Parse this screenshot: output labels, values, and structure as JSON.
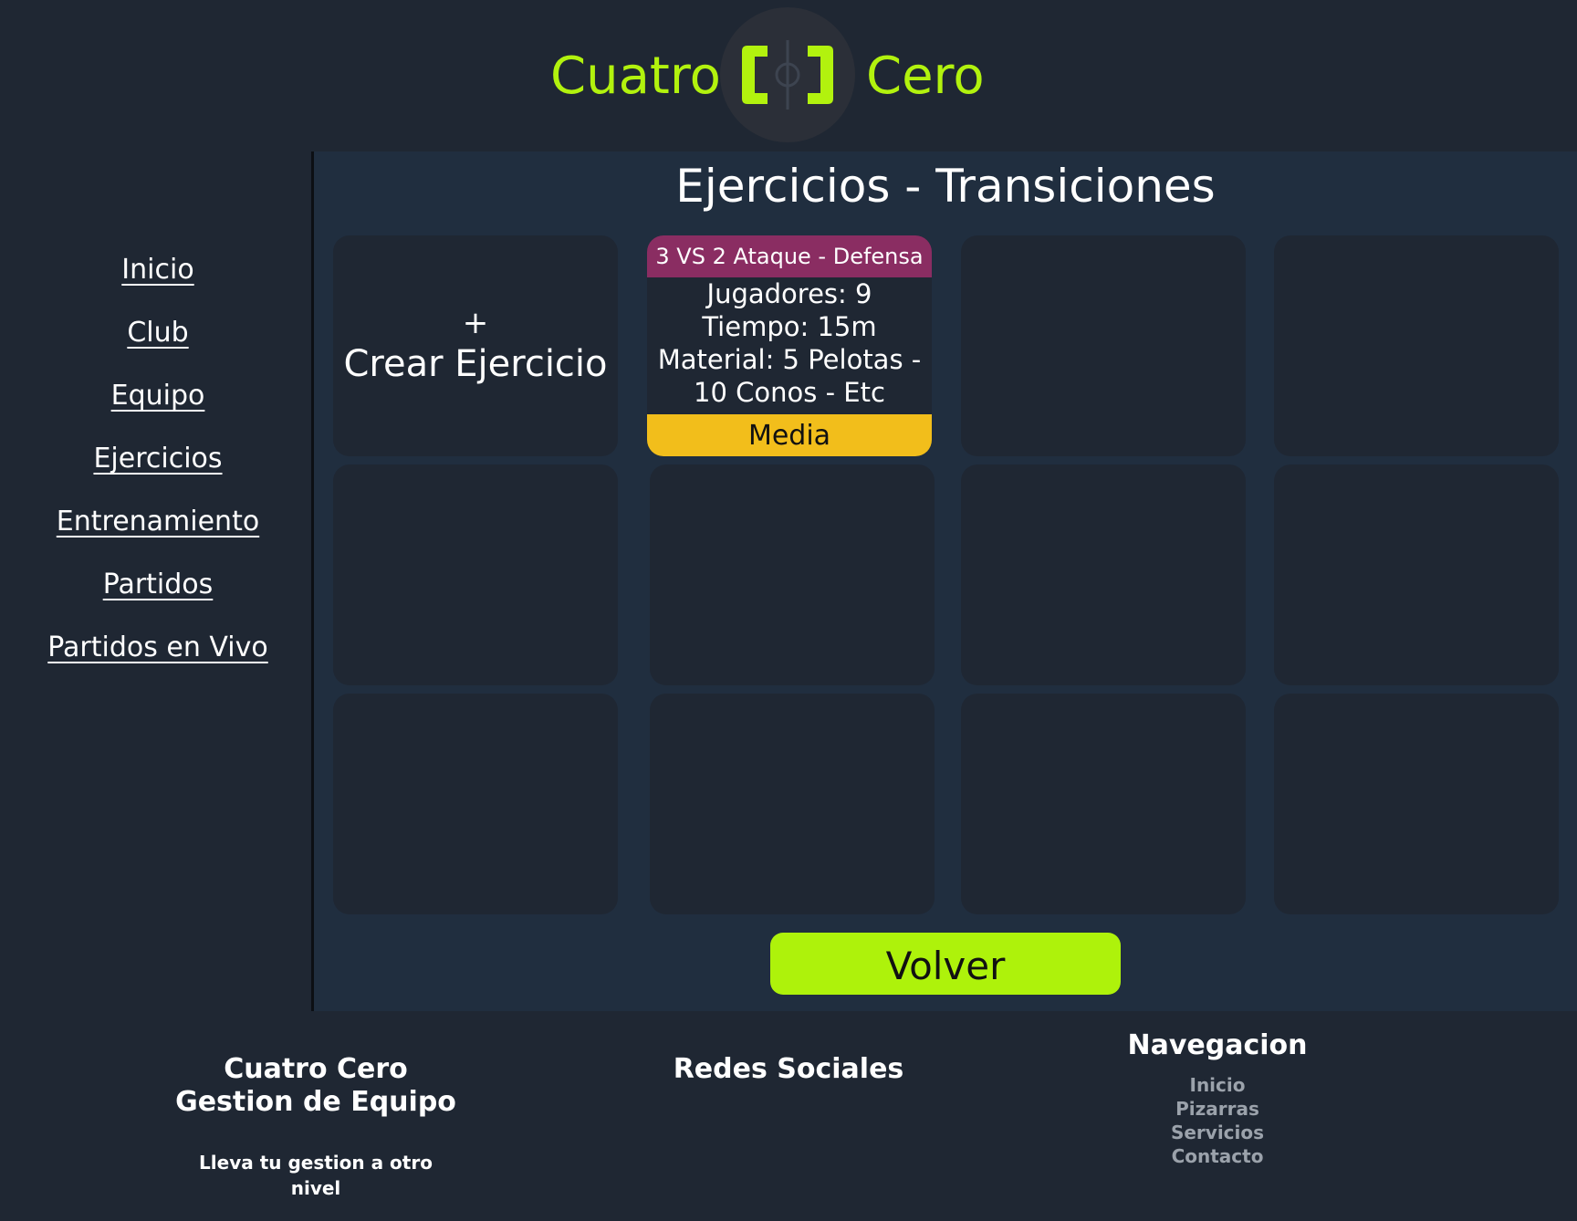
{
  "header": {
    "brand_left": "Cuatro",
    "brand_right": "Cero",
    "logo_icon": "bracket-ball-logo-icon",
    "accent_color": "#b2f20e"
  },
  "sidebar": {
    "items": [
      {
        "label": "Inicio"
      },
      {
        "label": "Club"
      },
      {
        "label": "Equipo"
      },
      {
        "label": "Ejercicios"
      },
      {
        "label": "Entrenamiento"
      },
      {
        "label": "Partidos"
      },
      {
        "label": "Partidos en Vivo"
      }
    ]
  },
  "main": {
    "title": "Ejercicios - Transiciones",
    "create_card": {
      "plus": "+",
      "label": "Crear Ejercicio"
    },
    "exercise": {
      "title": "3 VS 2 Ataque - Defensa",
      "lines": [
        "Jugadores: 9",
        "Tiempo: 15m",
        "Material: 5 Pelotas -",
        "10 Conos - Etc"
      ],
      "level": "Media",
      "title_color": "#8a2d62",
      "level_color": "#f2be1b"
    },
    "back_button": "Volver",
    "back_color": "#aef20b"
  },
  "footer": {
    "brand_line1": "Cuatro Cero",
    "brand_line2": "Gestion de Equipo",
    "tagline": "Lleva tu gestion a otro nivel",
    "social_title": "Redes Sociales",
    "nav_title": "Navegacion",
    "nav_links": [
      "Inicio",
      "Pizarras",
      "Servicios",
      "Contacto"
    ]
  }
}
